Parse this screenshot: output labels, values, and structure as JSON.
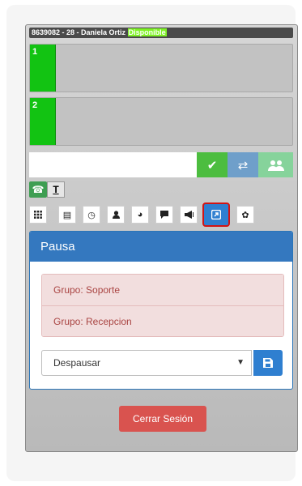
{
  "status": {
    "agent": "8639082 - 28 - Daniela Ortiz",
    "state": "Disponible",
    "state_color": "#7ff226"
  },
  "lines": [
    {
      "number": "1"
    },
    {
      "number": "2"
    }
  ],
  "dial": {
    "value": "",
    "placeholder": "",
    "buttons": [
      "check-icon",
      "transfer-icon",
      "conference-icon"
    ]
  },
  "modes": [
    "phone-icon",
    "text-format-icon"
  ],
  "toolbar": [
    "grid-icon",
    "list-icon",
    "clock-icon",
    "user-icon",
    "globe-icon",
    "chat-icon",
    "megaphone-icon",
    "external-link-icon",
    "gear-icon"
  ],
  "pausa": {
    "title": "Pausa",
    "grupos": [
      "Grupo: Soporte",
      "Grupo: Recepcion"
    ],
    "select_value": "Despausar"
  },
  "logout_label": "Cerrar Sesión",
  "colors": {
    "line_active": "#12c312",
    "accent": "#3478bf",
    "danger": "#d9534f",
    "highlight_border": "#d21414"
  }
}
